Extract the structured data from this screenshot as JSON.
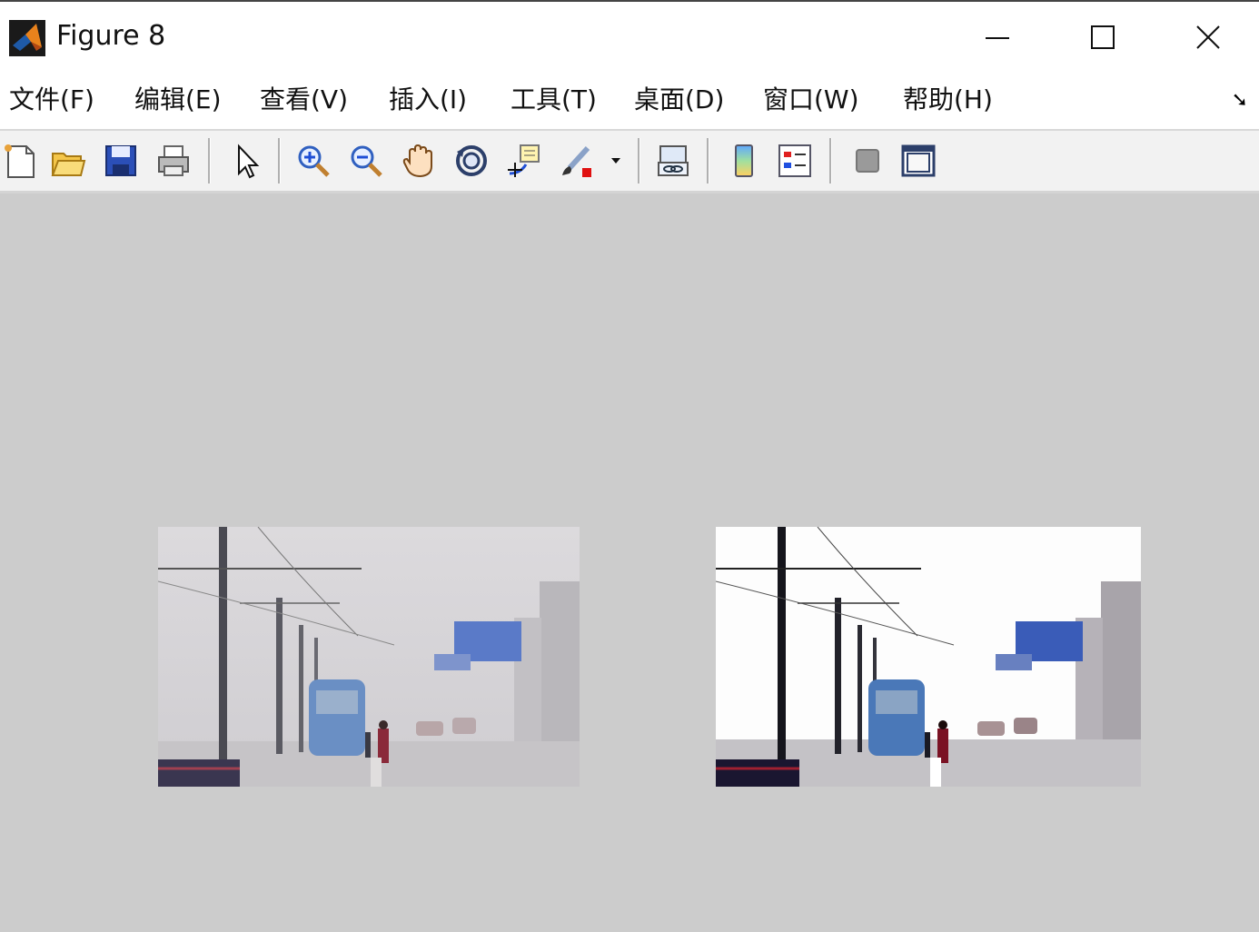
{
  "window": {
    "title": "Figure 8"
  },
  "menu": [
    {
      "label": "文件(F)"
    },
    {
      "label": "编辑(E)"
    },
    {
      "label": "查看(V)"
    },
    {
      "label": "插入(I)"
    },
    {
      "label": "工具(T)"
    },
    {
      "label": "桌面(D)"
    },
    {
      "label": "窗口(W)"
    },
    {
      "label": "帮助(H)"
    }
  ],
  "toolbar": {
    "icons": [
      "new-figure-icon",
      "open-icon",
      "save-icon",
      "print-icon",
      "pointer-icon",
      "zoom-in-icon",
      "zoom-out-icon",
      "pan-hand-icon",
      "rotate-3d-icon",
      "data-cursor-icon",
      "brush-icon",
      "brush-dropdown-icon",
      "link-plot-icon",
      "colorbar-icon",
      "legend-icon",
      "hide-plot-tools-icon",
      "show-plot-tools-icon"
    ]
  },
  "colors": {
    "figure_bg": "#cccccc",
    "toolbar_bg": "#f2f2f2",
    "accent_blue": "#1f4fd6"
  },
  "images": [
    {
      "name": "hazy-original",
      "description_shown": "foggy street with tram"
    },
    {
      "name": "dehazed-result",
      "description_shown": "enhanced street with tram"
    }
  ]
}
